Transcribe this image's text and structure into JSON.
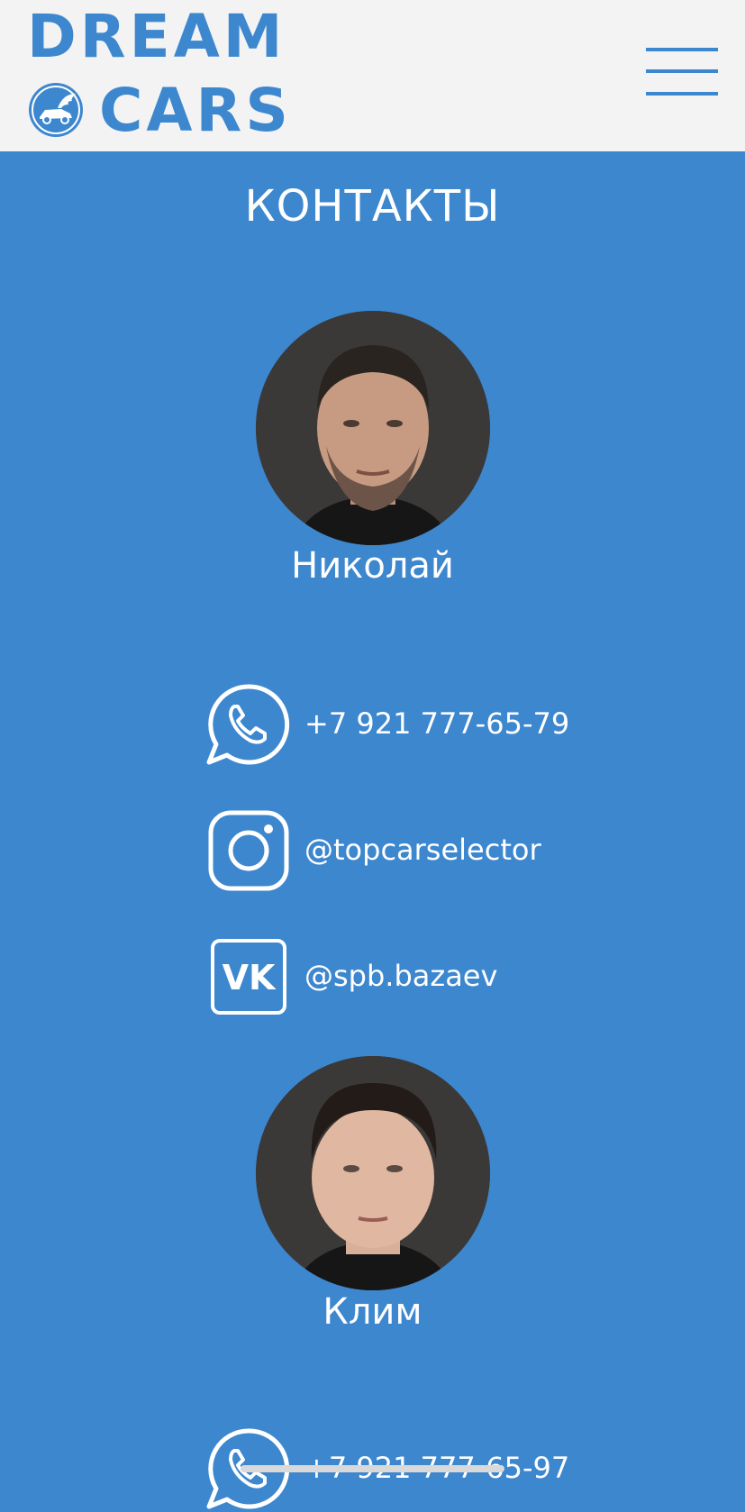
{
  "header": {
    "logo_line_1": "DREAM",
    "logo_line_2": "CARS",
    "logo_icon": "winged-car-emblem",
    "menu_icon": "hamburger-icon"
  },
  "contacts_section": {
    "title": "КОНТАКТЫ"
  },
  "people": [
    {
      "name": "Николай",
      "photo": "avatar-photo",
      "contacts": [
        {
          "icon": "whatsapp-icon",
          "text": "+7 921 777-65-79"
        },
        {
          "icon": "instagram-icon",
          "text": "@topcarselector"
        },
        {
          "icon": "vk-icon",
          "text": "@spb.bazaev"
        }
      ]
    },
    {
      "name": "Клим",
      "photo": "avatar-photo",
      "contacts": [
        {
          "icon": "whatsapp-icon",
          "text": "+7 921 777-65-97"
        }
      ]
    }
  ],
  "colors": {
    "brand_blue": "#3d87cf",
    "header_bg": "#f3f3f3",
    "text_white": "#ffffff"
  }
}
